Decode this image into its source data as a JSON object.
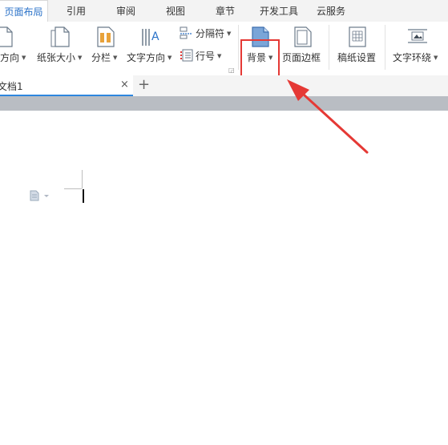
{
  "tabs": [
    {
      "label": "页面布局",
      "active": true
    },
    {
      "label": "引用",
      "active": false
    },
    {
      "label": "审阅",
      "active": false
    },
    {
      "label": "视图",
      "active": false
    },
    {
      "label": "章节",
      "active": false
    },
    {
      "label": "开发工具",
      "active": false
    },
    {
      "label": "云服务",
      "active": false
    }
  ],
  "ribbon": {
    "orientation": "方向",
    "paper_size": "纸张大小",
    "columns": "分栏",
    "text_direction": "文字方向",
    "separator": "分隔符",
    "line_number": "行号",
    "background": "背景",
    "page_border": "页面边框",
    "grid_paper": "稿纸设置",
    "text_wrap": "文字环绕"
  },
  "document": {
    "tab_title": "文档1",
    "close_symbol": "×",
    "new_symbol": "+"
  },
  "colors": {
    "accent": "#2a72c8",
    "highlight": "#e53935"
  }
}
